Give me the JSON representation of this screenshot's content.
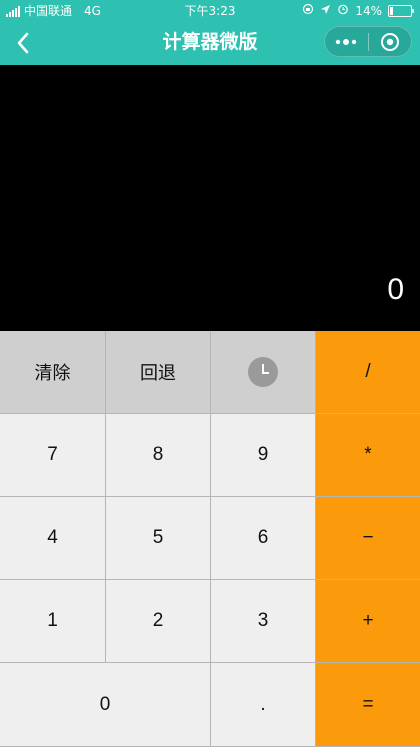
{
  "status": {
    "carrier": "中国联通",
    "network": "4G",
    "time": "下午3:23",
    "battery": "14%",
    "battery_level": 0.14
  },
  "nav": {
    "title": "计算器微版",
    "icons": {
      "back": "back-chevron-icon",
      "more": "more-dots-icon",
      "close": "close-target-icon"
    }
  },
  "display": {
    "value": "0"
  },
  "keys": {
    "clear": "清除",
    "backspace": "回退",
    "history_icon": "clock-icon",
    "divide": "/",
    "seven": "7",
    "eight": "8",
    "nine": "9",
    "multiply": "*",
    "four": "4",
    "five": "5",
    "six": "6",
    "minus": "−",
    "one": "1",
    "two": "2",
    "three": "3",
    "plus": "+",
    "zero": "0",
    "dot": ".",
    "equals": "="
  },
  "colors": {
    "nav_bg": "#2ec0b0",
    "display_bg": "#000000",
    "operator_bg": "#fb9a0a",
    "function_bg": "#cfcfcf",
    "number_bg": "#efefef"
  }
}
